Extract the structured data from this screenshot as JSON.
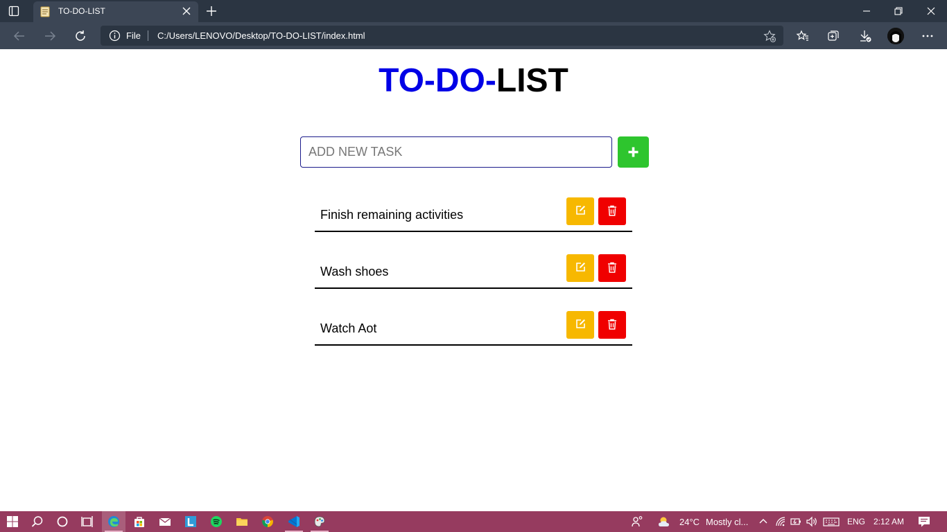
{
  "browser": {
    "tab_title": "TO-DO-LIST",
    "address_prefix": "File",
    "address_url": "C:/Users/LENOVO/Desktop/TO-DO-LIST/index.html"
  },
  "page": {
    "title_part1": "TO-DO-",
    "title_part2": "LIST",
    "input_placeholder": "ADD NEW TASK",
    "tasks": [
      {
        "text": "Finish remaining activities"
      },
      {
        "text": "Wash shoes"
      },
      {
        "text": "Watch Aot"
      }
    ]
  },
  "colors": {
    "title_accent": "#0000e6",
    "add_button": "#2ec52e",
    "edit_button": "#f7b800",
    "delete_button": "#f00000",
    "taskbar": "#963b5f"
  },
  "taskbar": {
    "temperature": "24°C",
    "weather": "Mostly cl...",
    "language": "ENG",
    "time": "2:12 AM"
  }
}
